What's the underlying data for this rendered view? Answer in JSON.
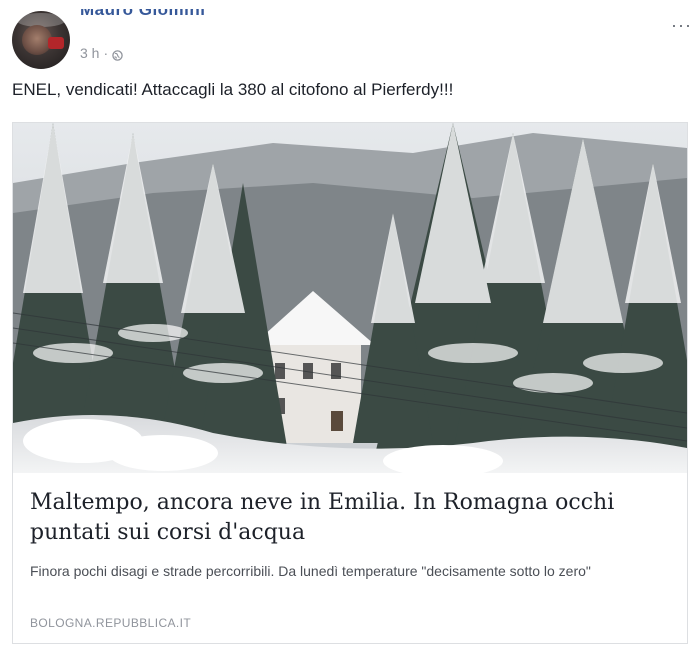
{
  "post": {
    "author": "Mauro Giomini",
    "time": "3 h",
    "separator": "·",
    "options_label": "···",
    "text": "ENEL, vendicati! Attaccagli la 380 al citofono al Pierferdy!!!"
  },
  "link_card": {
    "title": "Maltempo, ancora neve in Emilia. In Romagna occhi puntati sui corsi d'acqua",
    "description": "Finora pochi disagi e strade percorribili. Da lunedì temperature \"decisamente sotto lo zero\"",
    "domain": "BOLOGNA.REPUBBLICA.IT"
  },
  "icons": {
    "privacy": "globe-icon",
    "options": "more-options-icon"
  },
  "colors": {
    "author": "#365899",
    "meta": "#90949c",
    "border": "#dddfe2"
  }
}
